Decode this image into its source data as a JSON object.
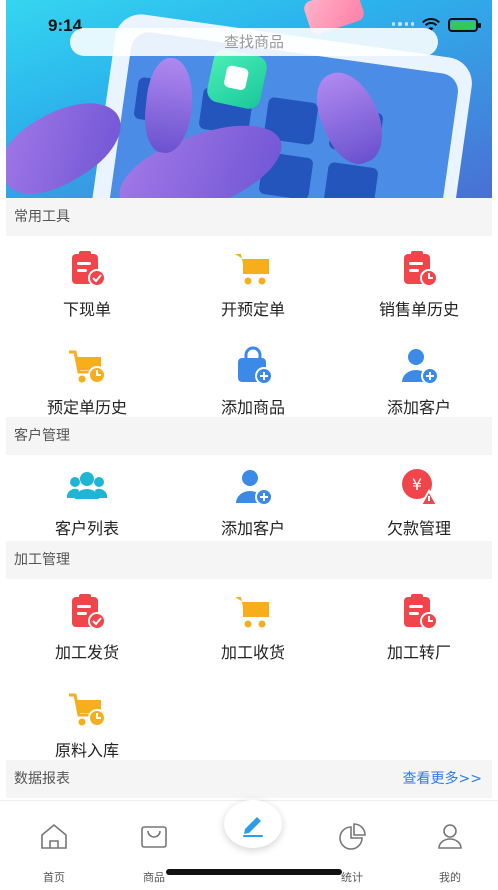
{
  "status": {
    "time": "9:14"
  },
  "search": {
    "placeholder": "查找商品"
  },
  "sections": [
    {
      "title": "常用工具",
      "items": [
        {
          "label": "下现单",
          "icon": "order-check-icon",
          "color": "#f0454b"
        },
        {
          "label": "开预定单",
          "icon": "cart-icon",
          "color": "#f6ae1c"
        },
        {
          "label": "销售单历史",
          "icon": "order-clock-icon",
          "color": "#f0454b"
        },
        {
          "label": "预定单历史",
          "icon": "cart-clock-icon",
          "color": "#f6ae1c"
        },
        {
          "label": "添加商品",
          "icon": "bag-add-icon",
          "color": "#3c8ae8"
        },
        {
          "label": "添加客户",
          "icon": "user-add-icon",
          "color": "#3c8ae8"
        }
      ]
    },
    {
      "title": "客户管理",
      "items": [
        {
          "label": "客户列表",
          "icon": "users-icon",
          "color": "#1fb6d6"
        },
        {
          "label": "添加客户",
          "icon": "user-add-icon",
          "color": "#3c8ae8"
        },
        {
          "label": "欠款管理",
          "icon": "debt-warning-icon",
          "color": "#f0454b"
        }
      ]
    },
    {
      "title": "加工管理",
      "items": [
        {
          "label": "加工发货",
          "icon": "order-check-icon",
          "color": "#f0454b"
        },
        {
          "label": "加工收货",
          "icon": "cart-icon",
          "color": "#f6ae1c"
        },
        {
          "label": "加工转厂",
          "icon": "order-clock-icon",
          "color": "#f0454b"
        },
        {
          "label": "原料入库",
          "icon": "cart-clock-icon",
          "color": "#f6ae1c"
        }
      ]
    },
    {
      "title": "数据报表",
      "more": "查看更多>>"
    }
  ],
  "tabs": [
    {
      "label": "首页",
      "icon": "home-icon"
    },
    {
      "label": "商品",
      "icon": "shopping-bag-icon"
    },
    {
      "label": "统计",
      "icon": "pie-chart-icon"
    },
    {
      "label": "我的",
      "icon": "person-icon"
    }
  ],
  "fab": {
    "icon": "edit-pen-icon"
  }
}
